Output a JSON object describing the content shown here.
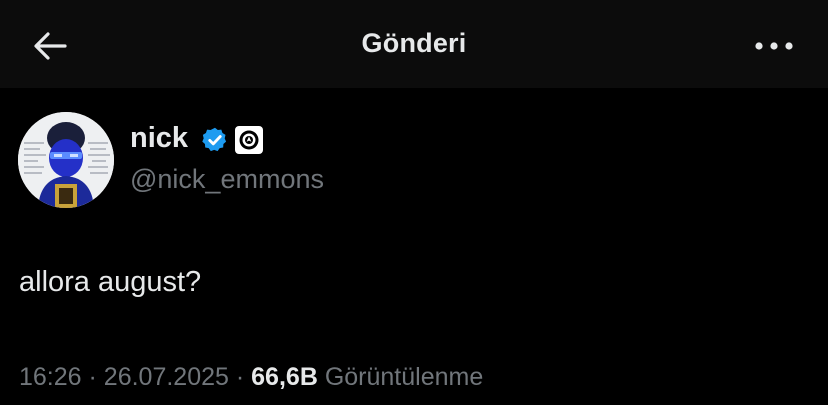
{
  "header": {
    "title": "Gönderi",
    "back_icon": "arrow-left-icon",
    "more_icon": "more-horizontal-icon"
  },
  "author": {
    "display_name": "nick",
    "handle": "@nick_emmons",
    "verified_icon": "verified-badge-icon",
    "affiliation_icon": "affiliation-badge-icon"
  },
  "tweet": {
    "text": "allora august?"
  },
  "meta": {
    "time": "16:26",
    "separator": "·",
    "date": "26.07.2025",
    "views_count": "66,6B",
    "views_label": "Görüntülenme"
  },
  "colors": {
    "background": "#000000",
    "header_bg": "#0c0c0c",
    "text_primary": "#e7e9ea",
    "text_secondary": "#71767b",
    "verified_blue": "#1d9bf0"
  }
}
